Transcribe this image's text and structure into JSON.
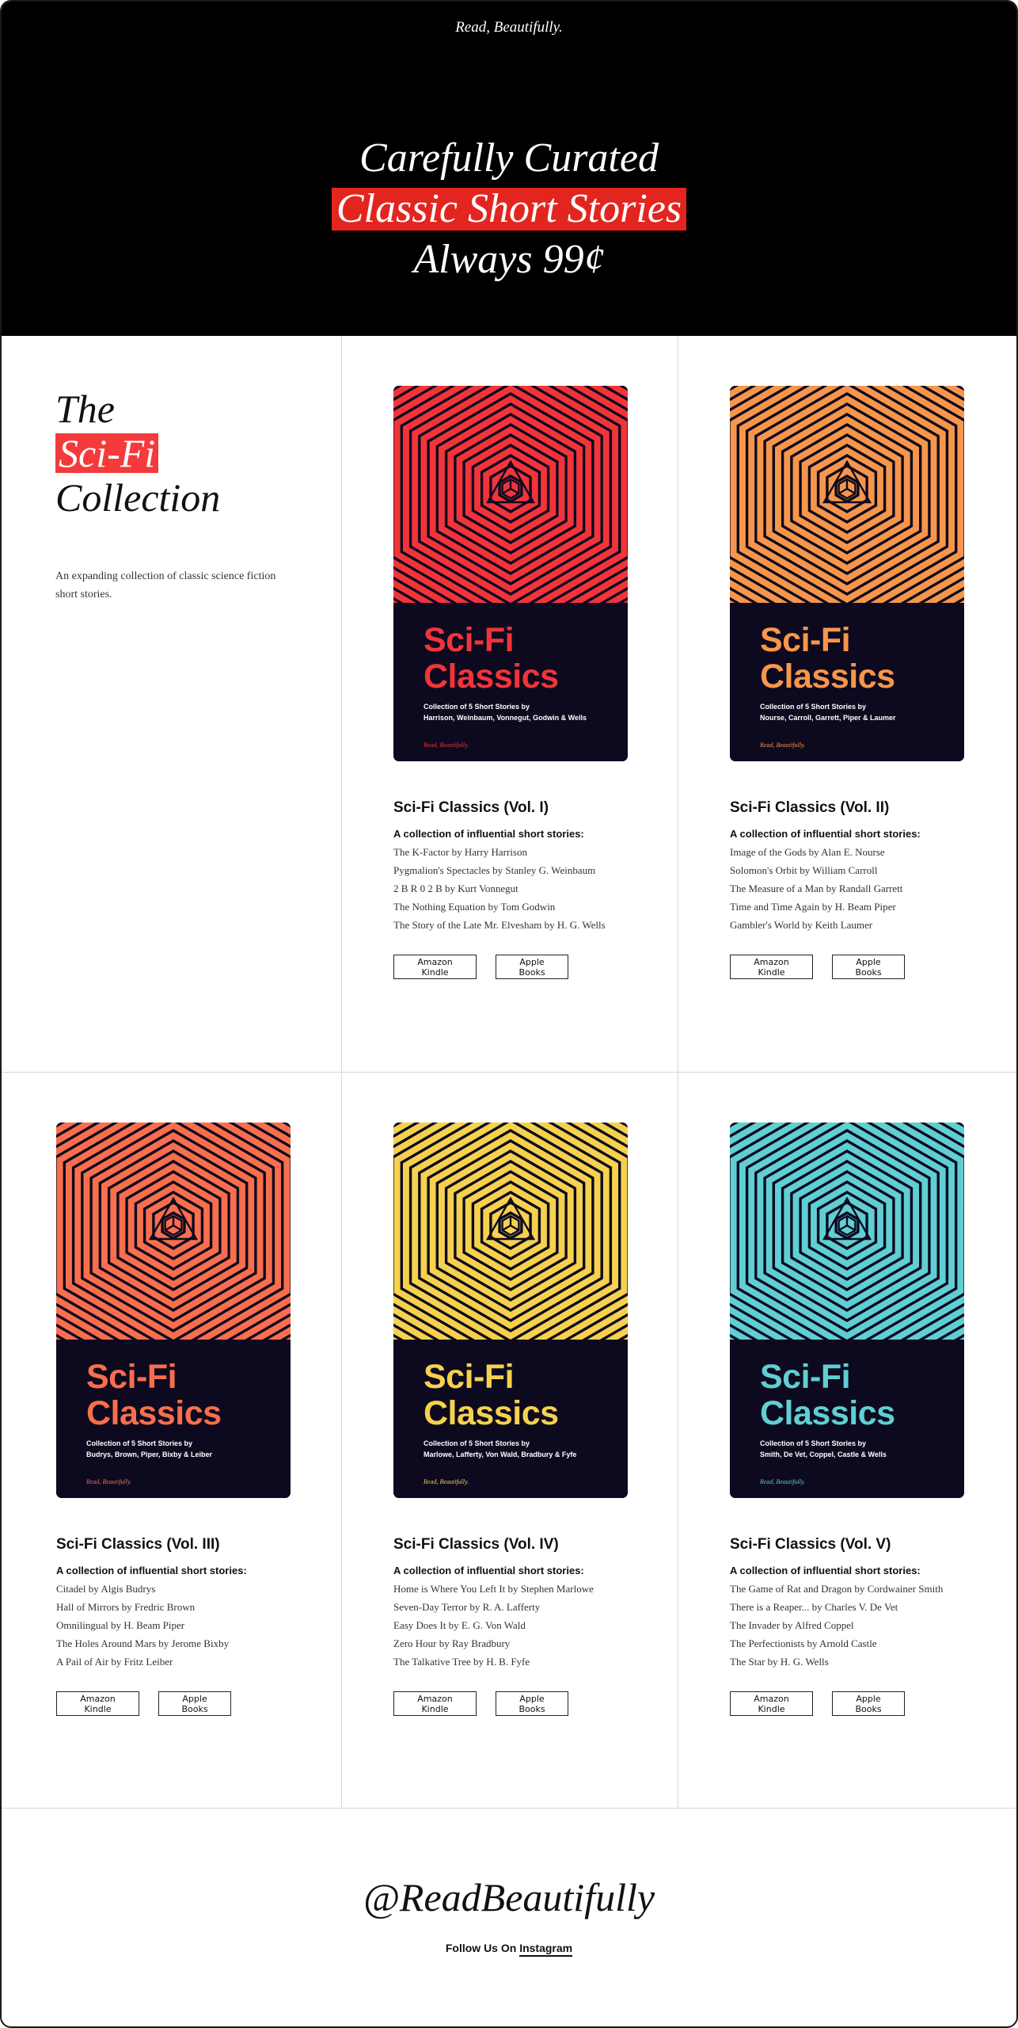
{
  "hero": {
    "tagline": "Read, Beautifully.",
    "line1": "Carefully Curated",
    "line2": "Classic Short Stories",
    "line3": "Always 99¢",
    "accent": "#e3251f"
  },
  "intro": {
    "title_line1": "The",
    "title_line2": "Sci-Fi",
    "title_line3": "Collection",
    "description": "An expanding collection of classic science fiction short stories."
  },
  "cover_labels": {
    "title_line1": "Sci-Fi",
    "title_line2": "Classics",
    "subtitle_prefix": "Collection of 5 Short Stories by",
    "brand": "Read, Beautifully."
  },
  "buttons": {
    "kindle": "Amazon Kindle",
    "apple": "Apple Books"
  },
  "books": [
    {
      "title": "Sci-Fi Classics (Vol. I)",
      "color": "#f2343a",
      "authors": "Harrison, Weinbaum, Vonnegut, Godwin & Wells",
      "subtitle": "A collection of  influential short stories:",
      "stories": [
        "The K-Factor by Harry Harrison",
        "Pygmalion's Spectacles by Stanley G. Weinbaum",
        "2 B R 0 2 B by Kurt Vonnegut",
        "The Nothing Equation by Tom Godwin",
        "The Story of the Late Mr. Elvesham by H. G. Wells"
      ]
    },
    {
      "title": "Sci-Fi Classics (Vol. II)",
      "color": "#f7964a",
      "authors": "Nourse, Carroll, Garrett, Piper & Laumer",
      "subtitle": "A collection of  influential short stories:",
      "stories": [
        "Image of the Gods by Alan E. Nourse",
        "Solomon's Orbit by William Carroll",
        "The Measure of a Man by Randall Garrett",
        "Time and Time Again by H. Beam Piper",
        "Gambler's World by Keith Laumer"
      ]
    },
    {
      "title": "Sci-Fi Classics (Vol. III)",
      "color": "#f96e4c",
      "authors": "Budrys, Brown, Piper, Bixby & Leiber",
      "subtitle": "A collection of  influential short stories:",
      "stories": [
        "Citadel by Algis Budrys",
        "Hall of Mirrors by Fredric Brown",
        "Omnilingual by H. Beam Piper",
        "The Holes Around Mars by Jerome Bixby",
        "A Pail of Air by Fritz Leiber"
      ]
    },
    {
      "title": "Sci-Fi Classics (Vol. IV)",
      "color": "#f6d14d",
      "authors": "Marlowe, Lafferty, Von Wald, Bradbury & Fyfe",
      "subtitle": "A collection of  influential short stories:",
      "stories": [
        "Home is Where You Left It by Stephen Marlowe",
        "Seven-Day Terror by R. A. Lafferty",
        "Easy Does It by E. G. Von Wald",
        "Zero Hour by Ray Bradbury",
        "The Talkative Tree by H. B. Fyfe"
      ]
    },
    {
      "title": "Sci-Fi Classics (Vol. V)",
      "color": "#5fcfd3",
      "authors": "Smith, De Vet, Coppel, Castle & Wells",
      "subtitle": "A collection of  influential short stories:",
      "stories": [
        "The Game of Rat and Dragon by Cordwainer Smith",
        "There is a Reaper... by Charles V. De Vet",
        "The Invader by Alfred Coppel",
        "The Perfectionists by Arnold Castle",
        "The Star by H. G. Wells"
      ]
    }
  ],
  "footer": {
    "handle": "@ReadBeautifully",
    "follow_prefix": "Follow Us On",
    "follow_link": "Instagram"
  }
}
